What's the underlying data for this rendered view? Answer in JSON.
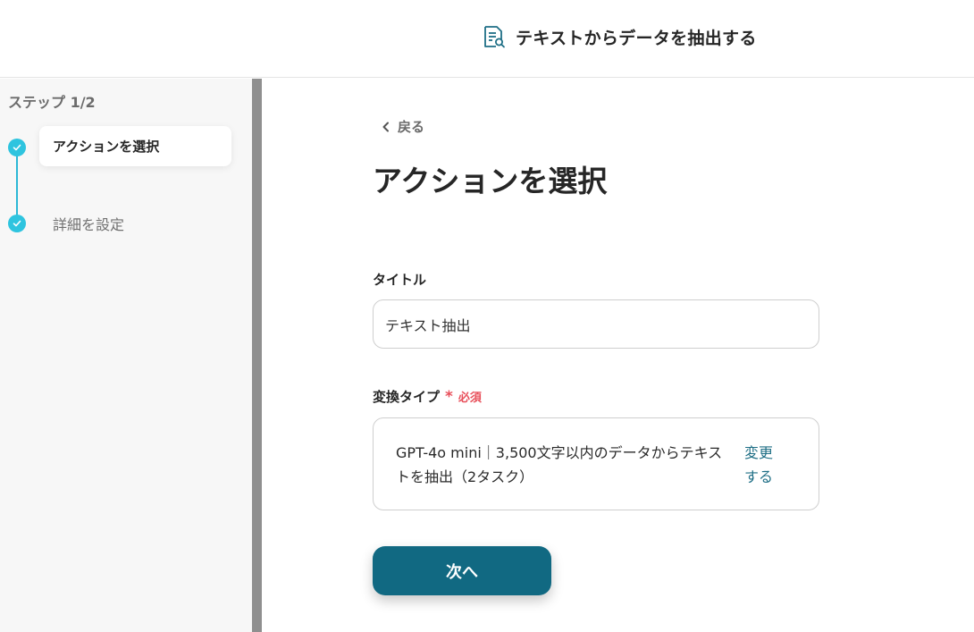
{
  "header": {
    "title": "テキストからデータを抽出する",
    "icon": "document-search-icon"
  },
  "sidebar": {
    "step_counter": "ステップ 1/2",
    "steps": [
      {
        "label": "アクションを選択",
        "status": "completed",
        "active": true
      },
      {
        "label": "詳細を設定",
        "status": "completed",
        "active": false
      }
    ]
  },
  "main": {
    "back_label": "戻る",
    "page_title": "アクションを選択",
    "title_field": {
      "label": "タイトル",
      "value": "テキスト抽出"
    },
    "type_field": {
      "label": "変換タイプ",
      "required_mark": "*",
      "required_text": "必須",
      "value": "GPT-4o mini｜3,500文字以内のデータからテキストを抽出（2タスク）",
      "change_label": "変更する"
    },
    "next_button": "次へ"
  },
  "colors": {
    "accent": "#116982",
    "step": "#2ec4df",
    "required": "#e8505b",
    "link": "#1f6f86"
  }
}
